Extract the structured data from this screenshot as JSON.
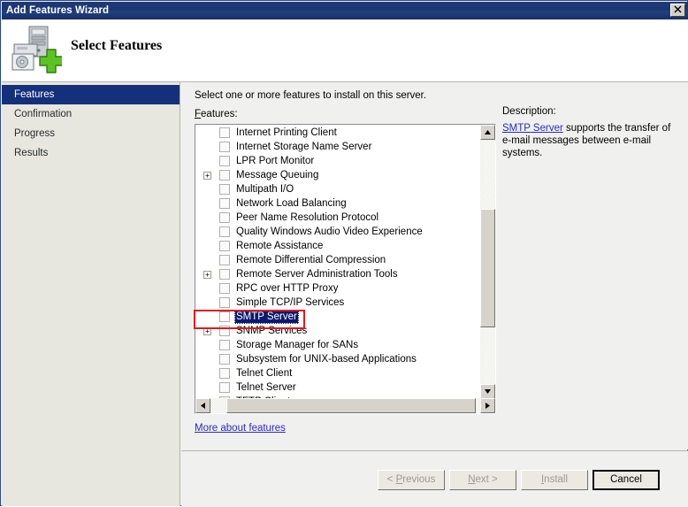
{
  "window": {
    "title": "Add Features Wizard",
    "close_label": "✕"
  },
  "header": {
    "title": "Select Features",
    "icon": "server-add-icon"
  },
  "sidebar": {
    "items": [
      {
        "label": "Features",
        "active": true
      },
      {
        "label": "Confirmation",
        "active": false
      },
      {
        "label": "Progress",
        "active": false
      },
      {
        "label": "Results",
        "active": false
      }
    ]
  },
  "main": {
    "instruction": "Select one or more features to install on this server.",
    "features_label": "Features:",
    "more_link": "More about features",
    "features": [
      {
        "label": "Internet Printing Client",
        "checked": false,
        "expandable": false,
        "selected": false
      },
      {
        "label": "Internet Storage Name Server",
        "checked": false,
        "expandable": false,
        "selected": false
      },
      {
        "label": "LPR Port Monitor",
        "checked": false,
        "expandable": false,
        "selected": false
      },
      {
        "label": "Message Queuing",
        "checked": false,
        "expandable": true,
        "selected": false
      },
      {
        "label": "Multipath I/O",
        "checked": false,
        "expandable": false,
        "selected": false
      },
      {
        "label": "Network Load Balancing",
        "checked": false,
        "expandable": false,
        "selected": false
      },
      {
        "label": "Peer Name Resolution Protocol",
        "checked": false,
        "expandable": false,
        "selected": false
      },
      {
        "label": "Quality Windows Audio Video Experience",
        "checked": false,
        "expandable": false,
        "selected": false
      },
      {
        "label": "Remote Assistance",
        "checked": false,
        "expandable": false,
        "selected": false
      },
      {
        "label": "Remote Differential Compression",
        "checked": false,
        "expandable": false,
        "selected": false
      },
      {
        "label": "Remote Server Administration Tools",
        "checked": false,
        "expandable": true,
        "selected": false
      },
      {
        "label": "RPC over HTTP Proxy",
        "checked": false,
        "expandable": false,
        "selected": false
      },
      {
        "label": "Simple TCP/IP Services",
        "checked": false,
        "expandable": false,
        "selected": false
      },
      {
        "label": "SMTP Server",
        "checked": false,
        "expandable": false,
        "selected": true
      },
      {
        "label": "SNMP Services",
        "checked": false,
        "expandable": true,
        "selected": false
      },
      {
        "label": "Storage Manager for SANs",
        "checked": false,
        "expandable": false,
        "selected": false
      },
      {
        "label": "Subsystem for UNIX-based Applications",
        "checked": false,
        "expandable": false,
        "selected": false
      },
      {
        "label": "Telnet Client",
        "checked": false,
        "expandable": false,
        "selected": false
      },
      {
        "label": "Telnet Server",
        "checked": false,
        "expandable": false,
        "selected": false
      },
      {
        "label": "TFTP Client",
        "checked": false,
        "expandable": false,
        "selected": false
      }
    ],
    "expander_glyph": "+"
  },
  "description": {
    "heading": "Description:",
    "link_text": "SMTP Server",
    "body_text": " supports the transfer of e-mail messages between e-mail systems."
  },
  "scrollbars": {
    "up_arrow": "▲",
    "down_arrow": "▼",
    "left_arrow": "◀",
    "right_arrow": "▶"
  },
  "footer": {
    "previous": "< Previous",
    "next": "Next >",
    "install": "Install",
    "cancel": "Cancel"
  },
  "colors": {
    "titlebar": "#1b3670",
    "sidebar_active": "#15307a",
    "selection": "#0a1a6e",
    "link": "#2b2bc4",
    "annotation": "#e01b1b"
  }
}
